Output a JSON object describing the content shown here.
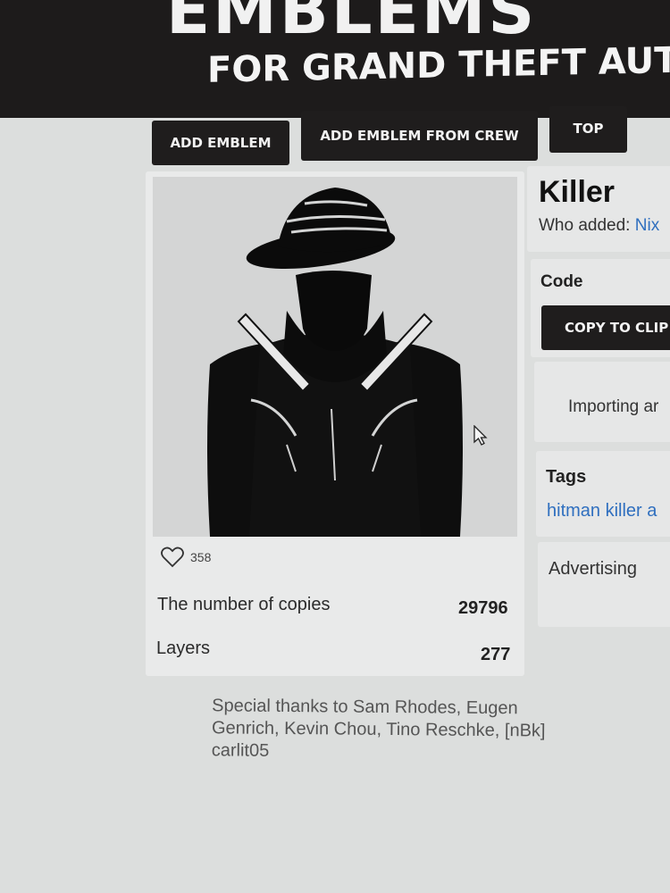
{
  "header": {
    "title_big": "EMBLEMS",
    "subtitle": "FOR GRAND THEFT AUTO"
  },
  "toolbar": {
    "add_emblem": "ADD EMBLEM",
    "add_from_crew": "ADD EMBLEM FROM CREW",
    "top": "TOP"
  },
  "emblem": {
    "likes": "358",
    "copies_label": "The number of copies",
    "copies_value": "29796",
    "layers_label": "Layers",
    "layers_value": "277",
    "thanks": "Special thanks to Sam Rhodes, Eugen Genrich, Kevin Chou, Tino Reschke, [nBk] carlit05"
  },
  "details": {
    "name": "Killer",
    "who_added_label": "Who added:",
    "who_added_value": "Nix",
    "code_label": "Code",
    "copy_button": "COPY TO CLIP",
    "importing": "Importing ar",
    "tags_label": "Tags",
    "tags_value": "hitman killer a",
    "advertising": "Advertising"
  },
  "icons": {
    "like": "heart-outline-icon",
    "cursor": "mouse-pointer-icon"
  },
  "colors": {
    "header_bg": "#1d1b1b",
    "button_bg": "#1f1d1d",
    "link": "#2f6fbf"
  }
}
